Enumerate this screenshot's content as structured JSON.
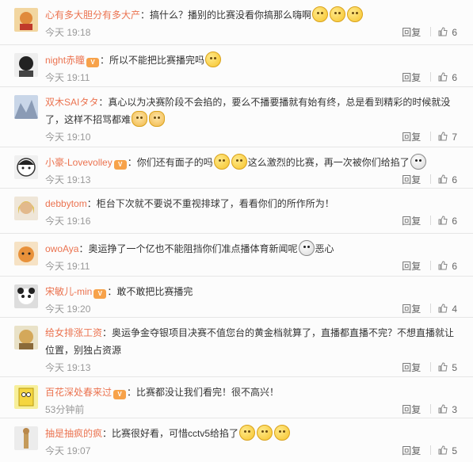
{
  "icons": {
    "vip": "vip-badge-icon",
    "thumb": "thumb-up-icon",
    "emoji": "emoji-face-icon"
  },
  "comments": [
    {
      "user": "心有多大胆分有多大产",
      "vip": false,
      "segments": [
        "：搞什么？播别的比赛没看你搞那么嗨啊"
      ],
      "emojis": 3,
      "time": "今天 19:18",
      "reply": "回复",
      "likes": "6"
    },
    {
      "user": "night赤瞳",
      "vip": true,
      "segments": [
        "：所以不能把比赛播完吗"
      ],
      "emojis": 1,
      "time": "今天 19:11",
      "reply": "回复",
      "likes": "6"
    },
    {
      "user": "双木SAIタタ",
      "vip": false,
      "segments": [
        "：真心以为决赛阶段不会掐的，要么不播要播就有始有终，总是看到精彩的时候就没了，这样不招骂都难"
      ],
      "emojis": 2,
      "time": "今天 19:10",
      "reply": "回复",
      "likes": "7"
    },
    {
      "user": "小豪-Lovevolley",
      "vip": true,
      "segments": [
        "：你们还有面子的吗",
        "这么激烈的比赛，再一次被你们给掐了"
      ],
      "emojis": 2,
      "time": "今天 19:13",
      "reply": "回复",
      "likes": "6"
    },
    {
      "user": "debbytom",
      "vip": false,
      "segments": [
        "：柜台下次就不要说不重视排球了，看看你们的所作所为！"
      ],
      "emojis": 0,
      "time": "今天 19:16",
      "reply": "回复",
      "likes": "6"
    },
    {
      "user": "owoAya",
      "vip": false,
      "segments": [
        "：奥运挣了一个亿也不能阻挡你们准点播体育新闻呢",
        "恶心"
      ],
      "emojis": 1,
      "time": "今天 19:11",
      "reply": "回复",
      "likes": "6"
    },
    {
      "user": "宋敏儿-min",
      "vip": true,
      "segments": [
        "：敢不敢把比赛播完"
      ],
      "emojis": 0,
      "time": "今天 19:20",
      "reply": "回复",
      "likes": "4"
    },
    {
      "user": "给女排涨工资",
      "vip": false,
      "segments": [
        "：奥运争金夺银项目决赛不值您台的黄金档就算了，直播都直播不完？不想直播就让位置，别独占资源"
      ],
      "emojis": 0,
      "time": "今天 19:13",
      "reply": "回复",
      "likes": "5"
    },
    {
      "user": "百花深处春来过",
      "vip": true,
      "segments": [
        "：比赛都没让我们看完！很不高兴！"
      ],
      "emojis": 0,
      "time": "53分钟前",
      "reply": "回复",
      "likes": "3"
    },
    {
      "user": "抽是抽疯的疯",
      "vip": false,
      "segments": [
        "：比赛很好看，可惜cctv5给掐了"
      ],
      "emojis": 3,
      "time": "今天 19:07",
      "reply": "回复",
      "likes": "5"
    }
  ],
  "vip_label": "V"
}
